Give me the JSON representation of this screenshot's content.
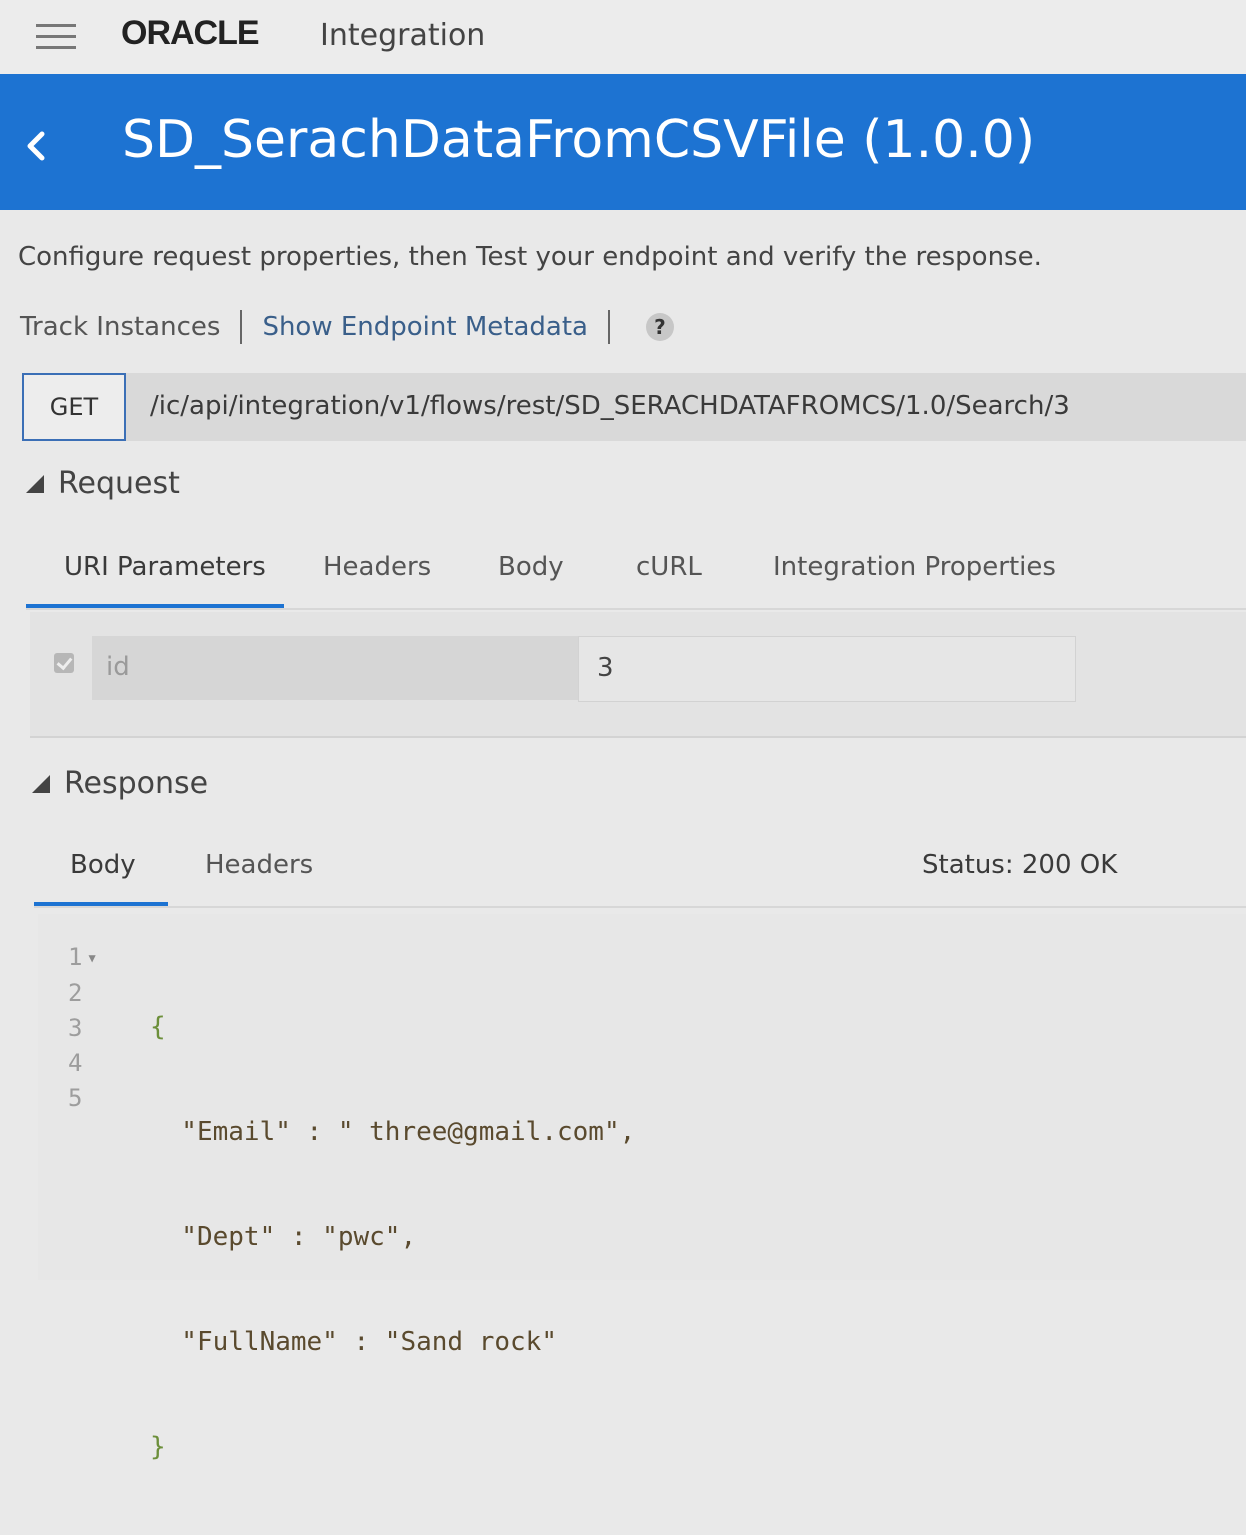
{
  "brand": {
    "logo": "ORACLE",
    "product": "Integration"
  },
  "header": {
    "title": "SD_SerachDataFromCSVFile (1.0.0)"
  },
  "description": "Configure request properties, then Test your endpoint and verify the response.",
  "links": {
    "track_instances": "Track Instances",
    "show_endpoint_metadata": "Show Endpoint Metadata",
    "help": "?"
  },
  "endpoint": {
    "method": "GET",
    "url": "/ic/api/integration/v1/flows/rest/SD_SERACHDATAFROMCS/1.0/Search/3"
  },
  "request": {
    "title": "Request",
    "tabs": [
      "URI Parameters",
      "Headers",
      "Body",
      "cURL",
      "Integration Properties"
    ],
    "active_tab": "URI Parameters",
    "params": [
      {
        "name": "id",
        "value": "3",
        "checked": true
      }
    ]
  },
  "response": {
    "title": "Response",
    "tabs": [
      "Body",
      "Headers"
    ],
    "active_tab": "Body",
    "status": "Status: 200 OK",
    "line_numbers": [
      "1",
      "2",
      "3",
      "4",
      "5"
    ],
    "lines": [
      "{",
      "  \"Email\" : \" three@gmail.com\",",
      "  \"Dept\" : \"pwc\",",
      "  \"FullName\" : \"Sand rock\"",
      "}"
    ]
  },
  "colors": {
    "banner": "#1d73d2",
    "tab_underline": "#1d73d2",
    "method_border": "#3b6fb6"
  },
  "icons": {
    "menu": "hamburger-icon",
    "back": "chevron-left-icon",
    "help": "help-icon",
    "collapse": "triangle-collapse-icon",
    "checkbox": "checkbox-checked-icon"
  }
}
